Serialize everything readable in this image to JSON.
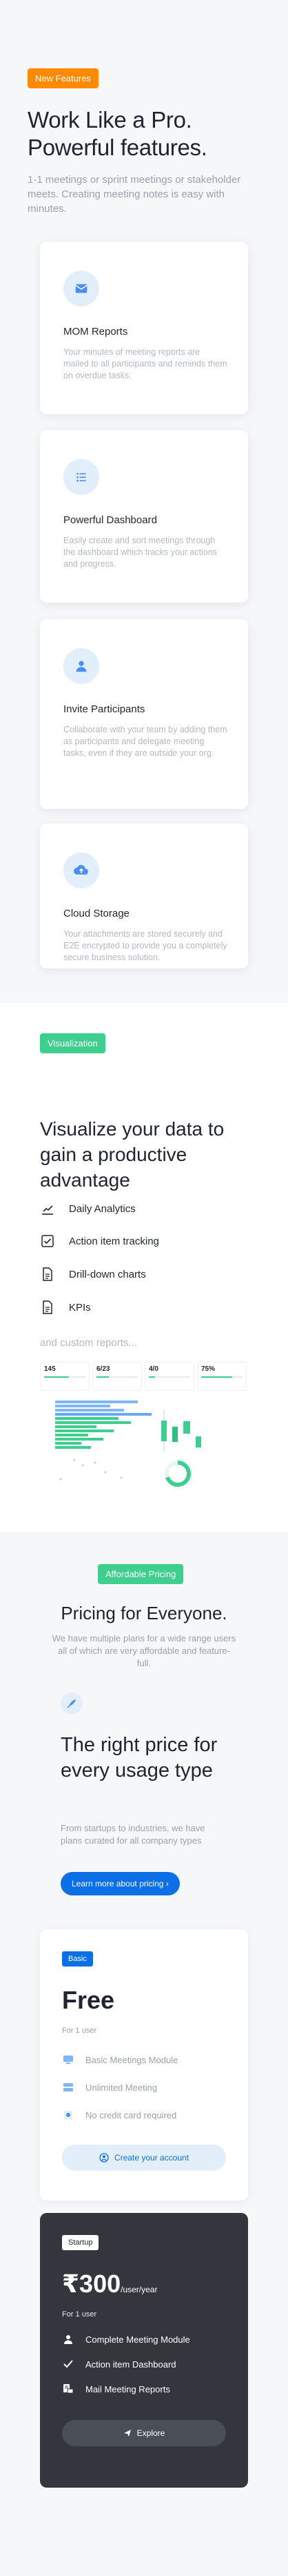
{
  "features": {
    "badge": "New Features",
    "heading": "Work Like a Pro. Powerful features.",
    "subheading": "1-1 meetings or sprint meetings or stakeholder meets. Creating meeting notes is easy with minutes.",
    "cards": [
      {
        "icon": "mail-icon",
        "title": "MOM Reports",
        "desc": "Your minutes of meeting reports are mailed to all participants and reminds them on overdue tasks."
      },
      {
        "icon": "list-icon",
        "title": "Powerful Dashboard",
        "desc": "Easily create and sort meetings through the dashboard which tracks your actions and progress."
      },
      {
        "icon": "user-icon",
        "title": "Invite Participants",
        "desc": "Collaborate with your team by adding them as participants and delegate meeting tasks, even if they are outside your org."
      },
      {
        "icon": "cloud-upload-icon",
        "title": "Cloud Storage",
        "desc": "Your attachments are stored securely and E2E encrypted to provide you a completely secure business solution."
      }
    ]
  },
  "visualization": {
    "badge": "Visualization",
    "heading": "Visualize your data to gain a productive advantage",
    "items": [
      {
        "icon": "chart-icon",
        "label": "Daily Analytics"
      },
      {
        "icon": "checkbox-icon",
        "label": "Action item tracking"
      },
      {
        "icon": "document-icon",
        "label": "Drill-down charts"
      },
      {
        "icon": "document-icon",
        "label": "KPIs"
      }
    ],
    "custom": "and custom reports...",
    "stats": [
      {
        "value": "145",
        "fill": 0.6
      },
      {
        "value": "6/23",
        "fill": 0.3
      },
      {
        "value": "4/0",
        "fill": 0.15
      },
      {
        "value": "75%",
        "fill": 0.75
      }
    ]
  },
  "pricing": {
    "badge": "Affordable Pricing",
    "heading": "Pricing for Everyone.",
    "subheading": "We have multiple plans for a wide range users all of which are very affordable and feature-full.",
    "right_heading": "The right price for every usage type",
    "right_sub": "From startups to industries, we have plans curated for all company types",
    "learn_btn": "Learn more about pricing ›",
    "plans": [
      {
        "badge": "Basic",
        "price": "Free",
        "per": "",
        "note": "For 1 user",
        "features": [
          {
            "icon": "screen-icon",
            "label": "Basic Meetings Module"
          },
          {
            "icon": "server-icon",
            "label": "Unlimited Meeting"
          },
          {
            "icon": "card-icon",
            "label": "No credit card required"
          }
        ],
        "button": "Create your account",
        "button_icon": "user-circle-icon"
      },
      {
        "badge": "Startup",
        "price": "₹300",
        "per": "/user/year",
        "note": "For 1 user",
        "features": [
          {
            "icon": "user-icon",
            "label": "Complete Meeting Module"
          },
          {
            "icon": "check-icon",
            "label": "Action item Dashboard"
          },
          {
            "icon": "mail-report-icon",
            "label": "Mail Meeting Reports"
          }
        ],
        "button": "Explore",
        "button_icon": "send-icon"
      }
    ]
  },
  "colors": {
    "accent_orange": "#ff8a00",
    "accent_green": "#3ecf8e",
    "accent_blue": "#0d6fe6",
    "dark_card": "#33363d"
  }
}
